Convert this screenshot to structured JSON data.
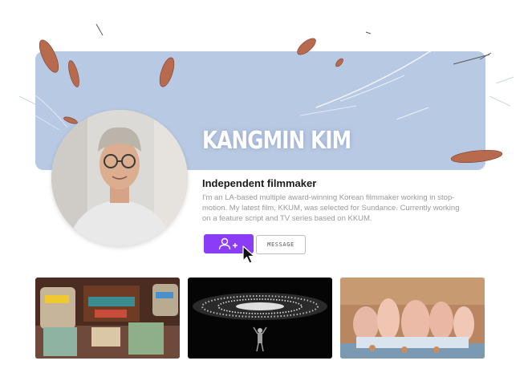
{
  "profile": {
    "name": "KANGMIN KIM",
    "role": "Independent filmmaker",
    "bio": "I'm an LA-based multiple award-winning Korean filmmaker working in stop-motion. My latest film, KKUM, was selected for Sundance. Currently working on a feature script and TV series based on KKUM."
  },
  "actions": {
    "follow_icon": "user-plus-icon",
    "message_label": "MESSAGE"
  },
  "gallery": [
    {
      "name": "thumbnail-stop-motion-room"
    },
    {
      "name": "thumbnail-light-ring"
    },
    {
      "name": "thumbnail-figurines"
    }
  ],
  "colors": {
    "banner": "#b8c9e3",
    "accent": "#8b3cf7",
    "leaf": "#b86a4e"
  }
}
